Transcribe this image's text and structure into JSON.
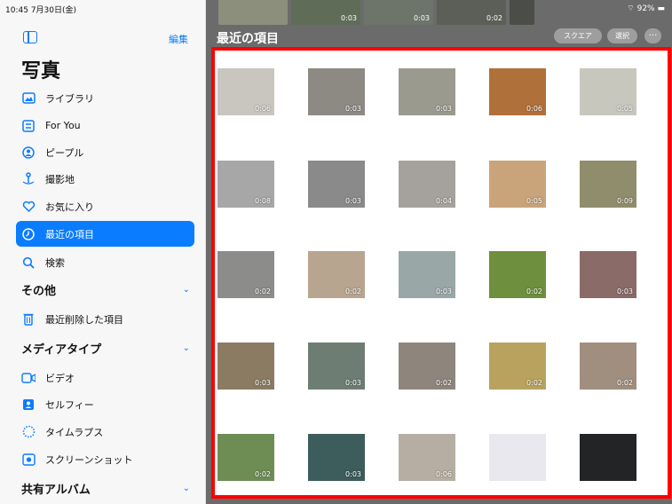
{
  "status": {
    "time": "10:45",
    "date": "7月30日(金)",
    "battery": "92%"
  },
  "sidebar": {
    "edit_label": "編集",
    "title": "写真",
    "items": [
      {
        "label": "ライブラリ",
        "icon": "library-icon",
        "active": false
      },
      {
        "label": "For You",
        "icon": "for-you-icon",
        "active": false
      },
      {
        "label": "ピープル",
        "icon": "people-icon",
        "active": false
      },
      {
        "label": "撮影地",
        "icon": "places-icon",
        "active": false
      },
      {
        "label": "お気に入り",
        "icon": "heart-icon",
        "active": false
      },
      {
        "label": "最近の項目",
        "icon": "clock-icon",
        "active": true
      },
      {
        "label": "検索",
        "icon": "search-icon",
        "active": false
      }
    ],
    "section_other": "その他",
    "other_items": [
      {
        "label": "最近削除した項目",
        "icon": "trash-icon"
      }
    ],
    "section_media": "メディアタイプ",
    "media_items": [
      {
        "label": "ビデオ",
        "icon": "video-icon"
      },
      {
        "label": "セルフィー",
        "icon": "selfie-icon"
      },
      {
        "label": "タイムラプス",
        "icon": "timelapse-icon"
      },
      {
        "label": "スクリーンショット",
        "icon": "screenshot-icon"
      }
    ],
    "section_shared": "共有アルバム"
  },
  "main": {
    "title": "最近の項目",
    "square_button": "スクエア",
    "select_button": "選択",
    "more_button": "···",
    "top_strip": [
      {
        "duration": ""
      },
      {
        "duration": "0:03"
      },
      {
        "duration": "0:03"
      },
      {
        "duration": "0:02"
      },
      {
        "duration": ""
      }
    ],
    "accent_color": "#0a7cff",
    "highlight_color": "#ff0000",
    "thumbnails": [
      {
        "duration": "0:06",
        "color": "#c9c6bf"
      },
      {
        "duration": "0:03",
        "color": "#8d8a84"
      },
      {
        "duration": "0:03",
        "color": "#9a9a8e"
      },
      {
        "duration": "0:06",
        "color": "#b0703a"
      },
      {
        "duration": "0:05",
        "color": "#c7c7be"
      },
      {
        "duration": "0:08",
        "color": "#a7a7a7"
      },
      {
        "duration": "0:03",
        "color": "#8a8a8a"
      },
      {
        "duration": "0:04",
        "color": "#a5a29d"
      },
      {
        "duration": "0:05",
        "color": "#c9a37a"
      },
      {
        "duration": "0:09",
        "color": "#8f8d6c"
      },
      {
        "duration": "0:02",
        "color": "#8c8c8a"
      },
      {
        "duration": "0:02",
        "color": "#b8a58f"
      },
      {
        "duration": "0:03",
        "color": "#9aa7a7"
      },
      {
        "duration": "0:02",
        "color": "#6e8f3e"
      },
      {
        "duration": "0:03",
        "color": "#8a6b68"
      },
      {
        "duration": "0:03",
        "color": "#8b7b62"
      },
      {
        "duration": "0:03",
        "color": "#6d7d74"
      },
      {
        "duration": "0:02",
        "color": "#8e857c"
      },
      {
        "duration": "0:02",
        "color": "#b8a25e"
      },
      {
        "duration": "0:02",
        "color": "#a08f7e"
      },
      {
        "duration": "0:02",
        "color": "#6d8d55"
      },
      {
        "duration": "0:03",
        "color": "#3d5c5c"
      },
      {
        "duration": "0:06",
        "color": "#b6aea2"
      },
      {
        "duration": "",
        "color": "#e8e8ee"
      },
      {
        "duration": "",
        "color": "#222426"
      }
    ]
  }
}
